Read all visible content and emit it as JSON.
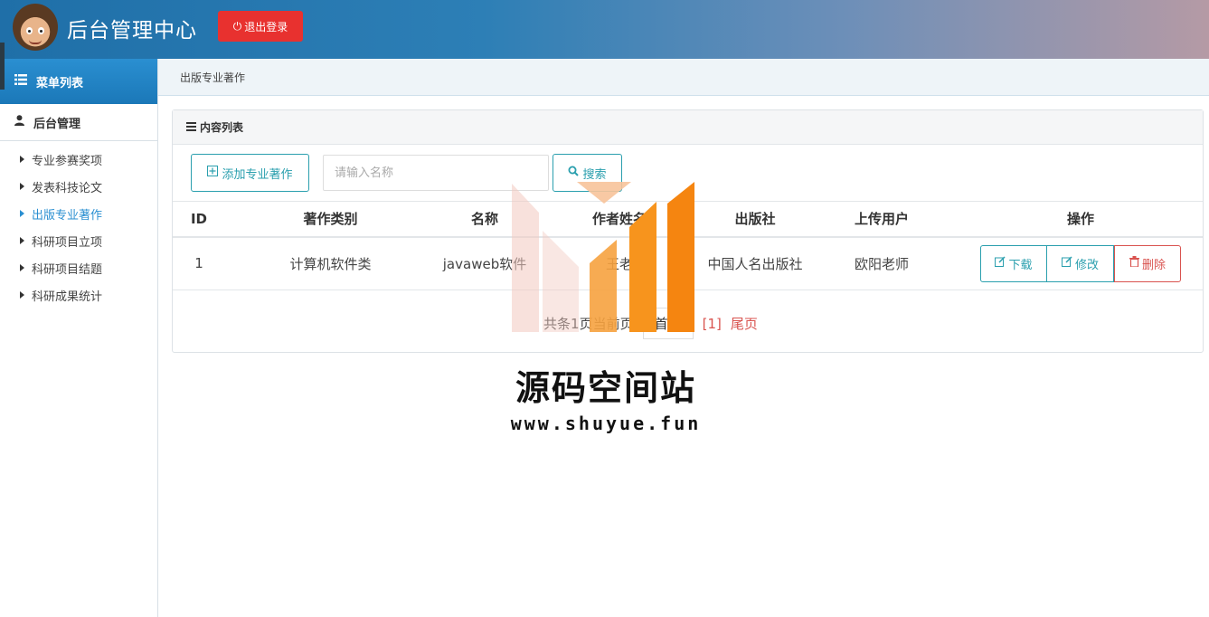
{
  "header": {
    "title": "后台管理中心",
    "logout_label": "退出登录"
  },
  "sidebar": {
    "menu_title": "菜单列表",
    "group_title": "后台管理",
    "items": [
      {
        "label": "专业参赛奖项"
      },
      {
        "label": "发表科技论文"
      },
      {
        "label": "出版专业著作"
      },
      {
        "label": "科研项目立项"
      },
      {
        "label": "科研项目结题"
      },
      {
        "label": "科研成果统计"
      }
    ]
  },
  "breadcrumb": "出版专业著作",
  "panel": {
    "title": "内容列表",
    "add_label": "添加专业著作",
    "search_placeholder": "请输入名称",
    "search_label": "搜索"
  },
  "table": {
    "headers": [
      "ID",
      "著作类别",
      "名称",
      "作者姓名",
      "出版社",
      "上传用户",
      "操作"
    ],
    "rows": [
      {
        "id": "1",
        "category": "计算机软件类",
        "name": "javaweb软件",
        "author": "王老",
        "publisher": "中国人名出版社",
        "uploader": "欧阳老师"
      }
    ],
    "actions": {
      "download": "下载",
      "edit": "修改",
      "delete": "删除"
    }
  },
  "pager": {
    "summary_a": "共",
    "summary_b": "条",
    "summary_c": "1页",
    "summary_d": "当前",
    "summary_e": "页",
    "first": "首页",
    "current": "[1]",
    "last": "尾页"
  },
  "watermark": {
    "text": "源码空间站",
    "url": "www.shuyue.fun"
  },
  "colors": {
    "accent": "#2a9fae",
    "danger": "#d9534f",
    "logout": "#e8312f",
    "sidebar_head": "#1b78b8"
  }
}
